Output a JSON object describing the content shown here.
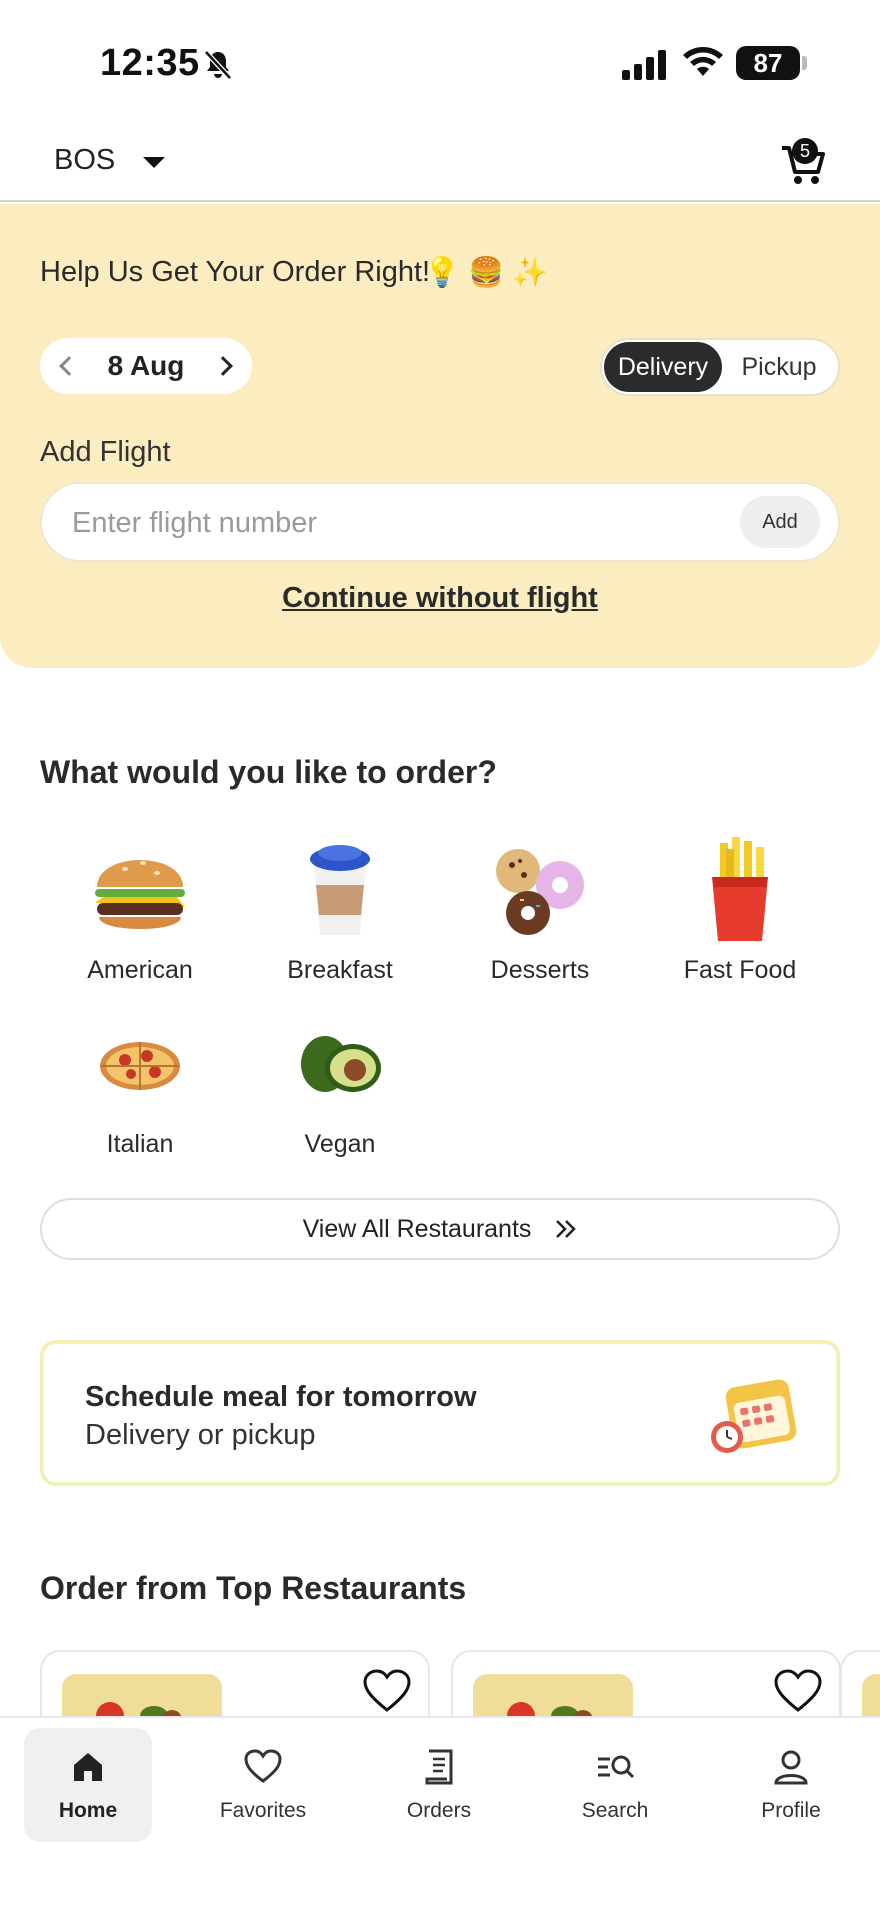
{
  "status_bar": {
    "time": "12:35",
    "battery": "87"
  },
  "header": {
    "airport": "BOS",
    "cart_count": "5"
  },
  "hero": {
    "title": "Help Us Get Your Order Right!",
    "title_emojis": "💡 🍔 ✨",
    "date": "8 Aug",
    "modes": [
      {
        "label": "Delivery",
        "active": true
      },
      {
        "label": "Pickup",
        "active": false
      }
    ],
    "flight_label": "Add Flight",
    "flight_placeholder": "Enter flight number",
    "add_label": "Add",
    "continue_label": "Continue without flight"
  },
  "categories": {
    "title": "What would you like to order?",
    "items": [
      {
        "label": "American",
        "icon": "burger-icon",
        "emoji": "🍔"
      },
      {
        "label": "Breakfast",
        "icon": "coffee-cup-icon",
        "emoji": "🥤"
      },
      {
        "label": "Desserts",
        "icon": "donuts-icon",
        "emoji": "🍩"
      },
      {
        "label": "Fast Food",
        "icon": "fries-icon",
        "emoji": "🍟"
      },
      {
        "label": "Italian",
        "icon": "pizza-icon",
        "emoji": "🍕"
      },
      {
        "label": "Vegan",
        "icon": "avocado-icon",
        "emoji": "🥑"
      }
    ],
    "view_all_label": "View All Restaurants"
  },
  "schedule": {
    "title": "Schedule meal for tomorrow",
    "subtitle": "Delivery or pickup"
  },
  "restaurants": {
    "title": "Order from Top Restaurants"
  },
  "bottom_nav": [
    {
      "label": "Home",
      "icon": "home-icon",
      "active": true
    },
    {
      "label": "Favorites",
      "icon": "heart-icon",
      "active": false
    },
    {
      "label": "Orders",
      "icon": "receipt-icon",
      "active": false
    },
    {
      "label": "Search",
      "icon": "search-icon",
      "active": false
    },
    {
      "label": "Profile",
      "icon": "profile-icon",
      "active": false
    }
  ]
}
